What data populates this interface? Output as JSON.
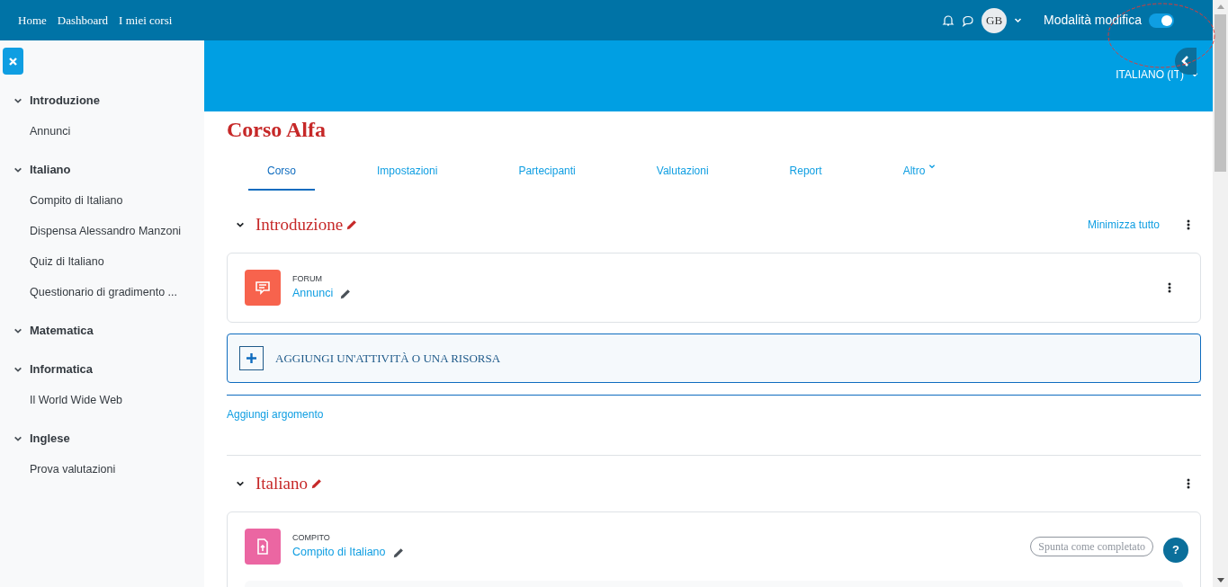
{
  "navbar": {
    "links": [
      {
        "label": "Home"
      },
      {
        "label": "Dashboard"
      },
      {
        "label": "I miei corsi"
      }
    ],
    "user_initials": "GB",
    "edit_mode": {
      "label": "Modalità modifica",
      "on": true
    }
  },
  "header": {
    "language": "ITALIANO (IT)"
  },
  "sidebar": {
    "sections": [
      {
        "title": "Introduzione",
        "expanded": true,
        "items": [
          "Annunci"
        ]
      },
      {
        "title": "Italiano",
        "expanded": true,
        "items": [
          "Compito di Italiano",
          "Dispensa Alessandro Manzoni",
          "Quiz di Italiano",
          "Questionario di gradimento ..."
        ]
      },
      {
        "title": "Matematica",
        "expanded": true
      },
      {
        "title": "Informatica",
        "expanded": true,
        "items": [
          "Il World Wide Web"
        ]
      },
      {
        "title": "Inglese",
        "expanded": true,
        "items": [
          "Prova valutazioni"
        ]
      }
    ]
  },
  "course": {
    "title": "Corso Alfa",
    "tabs": [
      {
        "label": "Corso",
        "selected": true,
        "menu": false
      },
      {
        "label": "Impostazioni",
        "selected": false,
        "menu": false
      },
      {
        "label": "Partecipanti",
        "selected": false,
        "menu": false
      },
      {
        "label": "Valutazioni",
        "selected": false,
        "menu": false
      },
      {
        "label": "Report",
        "selected": false,
        "menu": false
      },
      {
        "label": "Altro",
        "selected": false,
        "menu": true
      }
    ],
    "collapse_all": "Minimizza tutto",
    "sections": [
      {
        "title": "Introduzione",
        "expanded": true,
        "activities": [
          {
            "kind": "forum",
            "type_label": "FORUM",
            "name": "Annunci",
            "color": "#f7634d"
          }
        ],
        "add_activity": "AGGIUNGI UN'ATTIVITÀ O UNA RISORSA",
        "add_topic": "Aggiungi argomento"
      },
      {
        "title": "Italiano",
        "expanded": true,
        "activities": [
          {
            "kind": "assign",
            "type_label": "COMPITO",
            "name": "Compito di Italiano",
            "color": "#eb66a2",
            "completion": "Spunta come completato"
          }
        ]
      }
    ]
  },
  "help": {
    "label": "?"
  }
}
